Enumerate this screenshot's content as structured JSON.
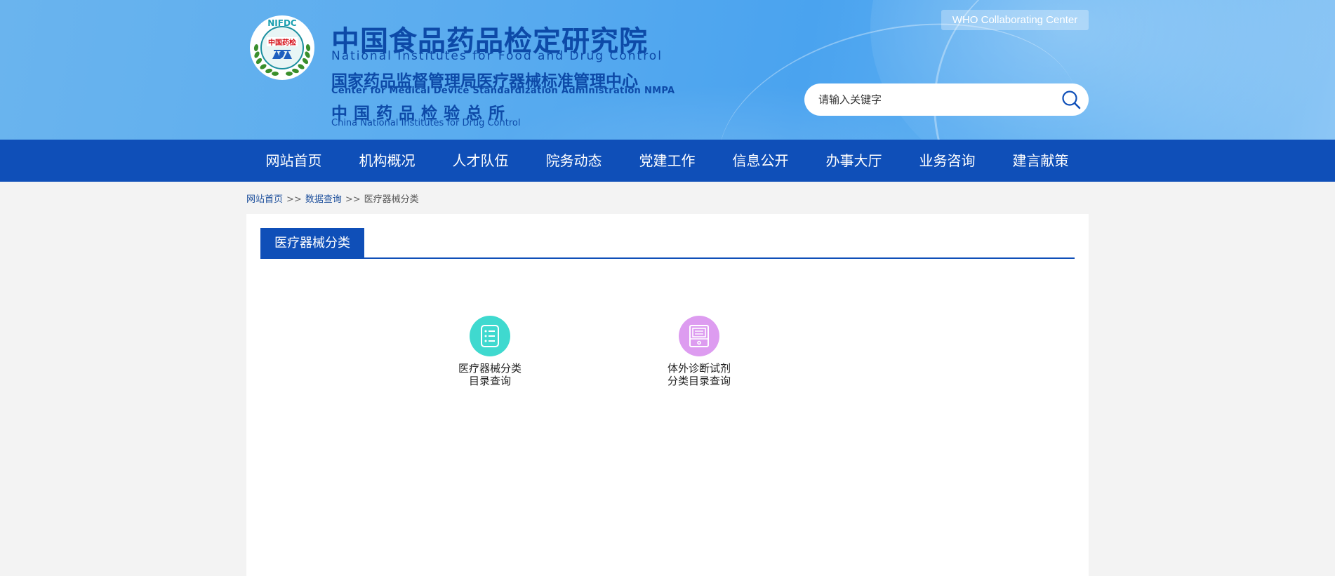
{
  "header": {
    "logo_text": "NIFDC",
    "logo_sub": "中国药检",
    "title_cn": "中国食品药品检定研究院",
    "title_en": "National Institutes for Food and Drug Control",
    "sub1_cn": "国家药品监督管理局医疗器械标准管理中心",
    "sub1_en": "Center for Medical Device Standardization Administration NMPA",
    "sub2_cn": "中国药品检验总所",
    "sub2_en": "China National Institutes for Drug Control",
    "who_label": "WHO Collaborating Center",
    "search": {
      "placeholder": "请输入关键字",
      "icon": "search-icon"
    }
  },
  "nav": {
    "items": [
      "网站首页",
      "机构概况",
      "人才队伍",
      "院务动态",
      "党建工作",
      "信息公开",
      "办事大厅",
      "业务咨询",
      "建言献策"
    ]
  },
  "breadcrumb": {
    "items": [
      "网站首页",
      "数据查询",
      "医疗器械分类"
    ],
    "separator": ">>"
  },
  "panel": {
    "tab": "医疗器械分类",
    "categories": [
      {
        "line1": "医疗器械分类",
        "line2": "目录查询",
        "icon": "list-icon",
        "color": "#3fd9cf"
      },
      {
        "line1": "体外诊断试剂",
        "line2": "分类目录查询",
        "icon": "device-icon",
        "color": "#dd9cf0"
      }
    ]
  },
  "colors": {
    "nav_bg": "#0f4fb8",
    "brand_text": "#0d4aa8",
    "page_bg": "#f3f3f3"
  }
}
